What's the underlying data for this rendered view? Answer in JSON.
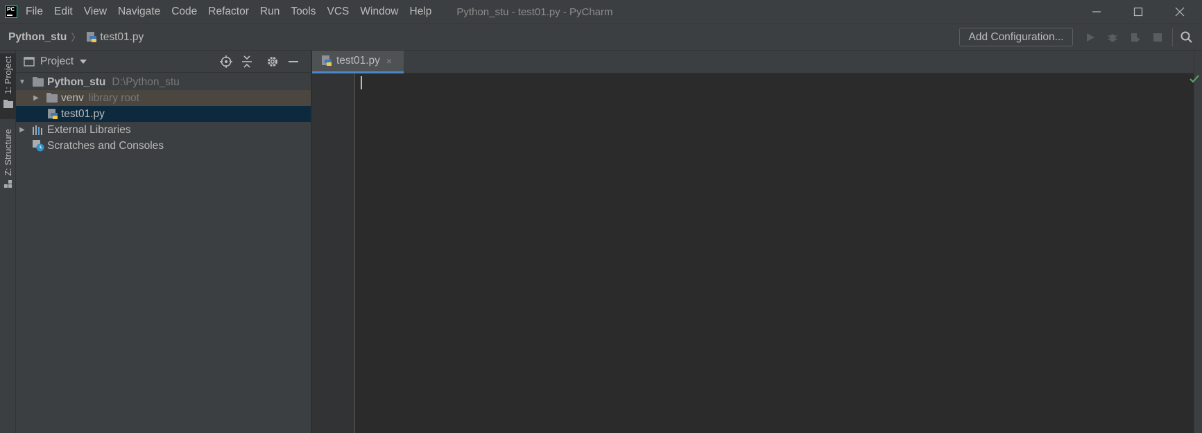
{
  "app": {
    "logo_text": "PC"
  },
  "menu": [
    {
      "label": "File"
    },
    {
      "label": "Edit"
    },
    {
      "label": "View"
    },
    {
      "label": "Navigate"
    },
    {
      "label": "Code"
    },
    {
      "label": "Refactor"
    },
    {
      "label": "Run"
    },
    {
      "label": "Tools"
    },
    {
      "label": "VCS"
    },
    {
      "label": "Window"
    },
    {
      "label": "Help"
    }
  ],
  "window_title": "Python_stu - test01.py - PyCharm",
  "navbar": {
    "project": "Python_stu",
    "file": "test01.py",
    "add_configuration": "Add Configuration..."
  },
  "left_stripe": {
    "project_tab": "1: Project",
    "structure_tab": "Z: Structure"
  },
  "project_panel": {
    "title": "Project",
    "tree": [
      {
        "label": "Python_stu",
        "hint": "D:\\Python_stu"
      },
      {
        "label": "venv",
        "hint": "library root"
      },
      {
        "label": "test01.py"
      },
      {
        "label": "External Libraries"
      },
      {
        "label": "Scratches and Consoles"
      }
    ]
  },
  "editor": {
    "tab_label": "test01.py",
    "tab_close": "×"
  },
  "colors": {
    "background": "#2b2b2b",
    "panel": "#3c3f41",
    "selection": "#0d293e",
    "library_root_highlight": "#4b4640",
    "accent": "#4a88c7",
    "pycharm_green": "#21d789"
  }
}
